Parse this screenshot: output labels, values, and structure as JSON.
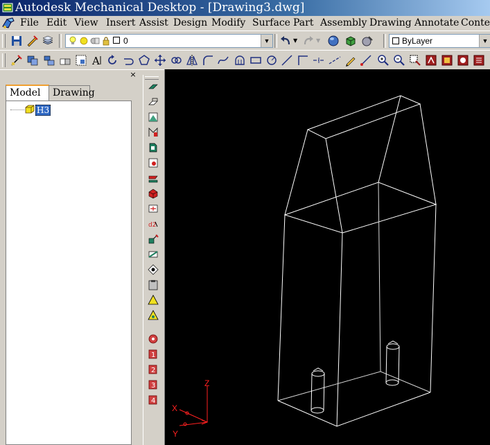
{
  "window": {
    "title": "Autodesk Mechanical Desktop - [Drawing3.dwg]"
  },
  "menu": [
    "File",
    "Edit",
    "View",
    "Insert",
    "Assist",
    "Design",
    "Modify",
    "Surface",
    "Part",
    "Assembly",
    "Drawing",
    "Annotate",
    "Content"
  ],
  "toolbar1": {
    "layer_combo": {
      "value": "0"
    },
    "linetype_combo": {
      "value": "ByLayer"
    }
  },
  "browser": {
    "close_label": "×",
    "tabs": [
      {
        "label": "Model",
        "active": true
      },
      {
        "label": "Drawing",
        "active": false
      }
    ],
    "tree": [
      {
        "label": "H3",
        "selected": true
      }
    ]
  },
  "ucs": {
    "x_label": "X",
    "y_label": "Y",
    "z_label": "Z"
  },
  "colors": {
    "title_start": "#0a246a",
    "title_end": "#a6caf0",
    "viewport_bg": "#000000",
    "wireframe": "#ffffff",
    "ucs_icon": "#ff0000",
    "selection": "#316ac5"
  }
}
